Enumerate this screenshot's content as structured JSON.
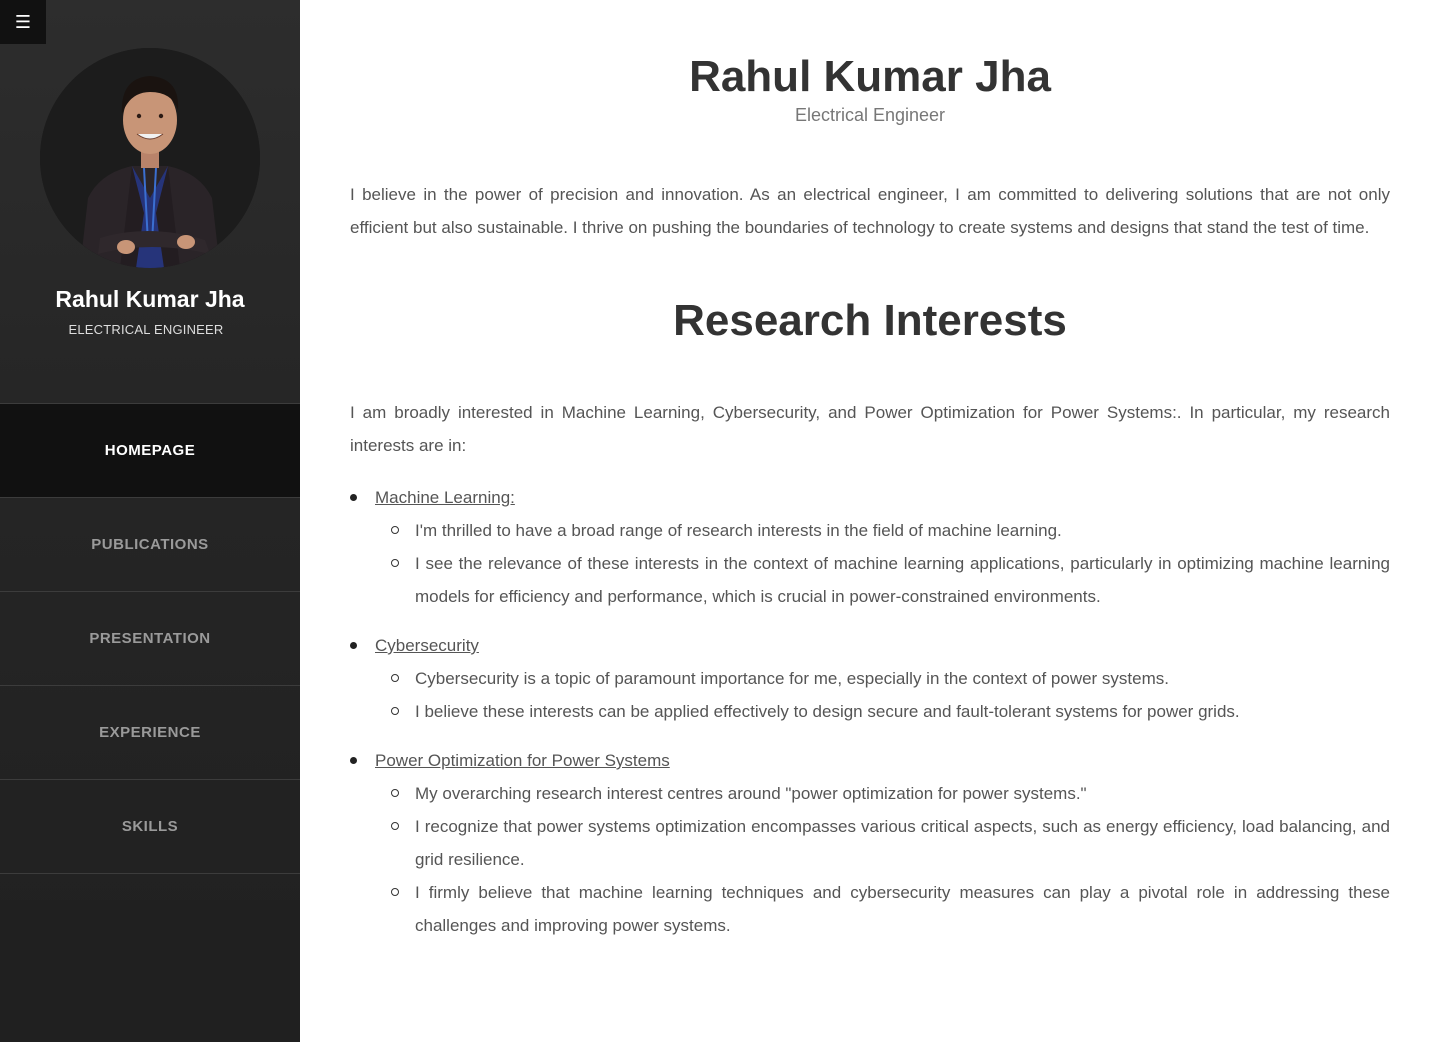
{
  "sidebar": {
    "menu_icon": "hamburger-icon",
    "menu_glyph": "☰",
    "avatar_alt": "profile-photo",
    "name": "Rahul Kumar Jha",
    "role": "ELECTRICAL ENGINEER",
    "nav": [
      {
        "label": "HOMEPAGE",
        "active": true
      },
      {
        "label": "PUBLICATIONS",
        "active": false
      },
      {
        "label": "PRESENTATION",
        "active": false
      },
      {
        "label": "EXPERIENCE",
        "active": false
      },
      {
        "label": "SKILLS",
        "active": false
      }
    ]
  },
  "main": {
    "title": "Rahul Kumar Jha",
    "subtitle": "Electrical Engineer",
    "intro": "I believe in the power of precision and innovation. As an electrical engineer, I am committed to delivering solutions that are not only efficient but also sustainable. I thrive on pushing the boundaries of technology to create systems and designs that stand the test of time.",
    "section_title": "Research Interests",
    "lead": "I am broadly interested in Machine Learning, Cybersecurity, and Power Optimization for Power Systems:. In particular, my research interests are in:",
    "topics": [
      {
        "title": "Machine Learning:",
        "items": [
          "I'm thrilled to have a broad range of research interests in the field of machine learning.",
          "I see the relevance of these interests in the context of machine learning applications, particularly in optimizing machine learning models for efficiency and performance, which is crucial in power-constrained environments."
        ]
      },
      {
        "title": "Cybersecurity",
        "items": [
          "Cybersecurity is a topic of paramount importance for me, especially in the context of power systems.",
          "I believe these interests can be applied effectively to design secure and fault-tolerant systems for power grids."
        ]
      },
      {
        "title": "Power Optimization for Power Systems",
        "items": [
          "My overarching research interest centres around \"power optimization for power systems.\"",
          "I recognize that power systems optimization encompasses various critical aspects, such as energy efficiency, load balancing, and grid resilience.",
          "I firmly believe that machine learning techniques and cybersecurity measures can play a pivotal role in addressing these challenges and improving power systems."
        ]
      }
    ]
  },
  "colors": {
    "sidebar_bg": "#2d2d2d",
    "nav_active_bg": "#111111",
    "nav_text": "#9a9a9a",
    "heading": "#333333",
    "body_text": "#555555"
  }
}
